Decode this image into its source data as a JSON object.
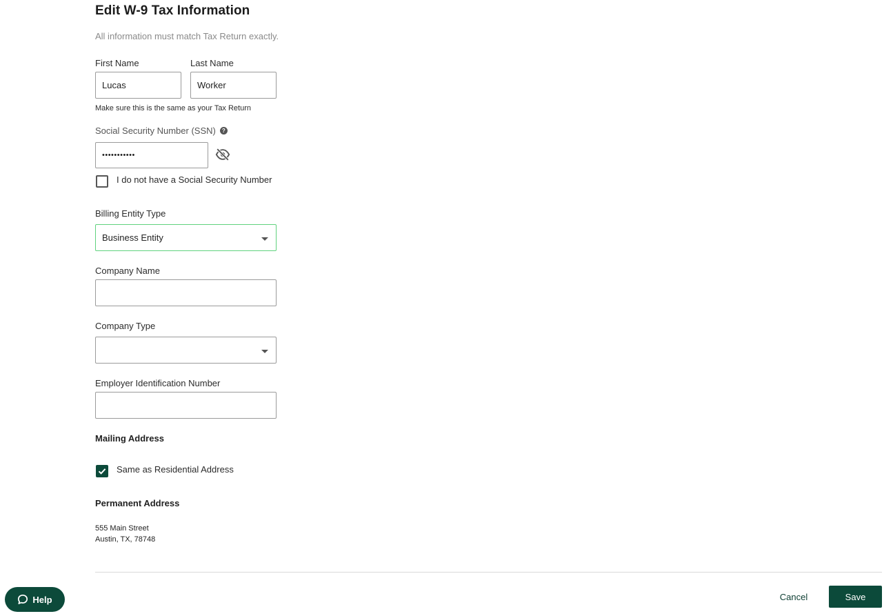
{
  "header": {
    "title": "Edit W-9 Tax Information",
    "subtitle": "All information must match Tax Return exactly."
  },
  "name": {
    "first_label": "First Name",
    "first_value": "Lucas",
    "last_label": "Last Name",
    "last_value": "Worker",
    "hint": "Make sure this is the same as your Tax Return"
  },
  "ssn": {
    "label": "Social Security Number (SSN)",
    "help_icon": "?",
    "value": "•••••••••••",
    "toggle_icon": "eye-off-icon",
    "no_ssn_label": "I do not have a Social Security Number",
    "no_ssn_checked": false
  },
  "billing": {
    "label": "Billing Entity Type",
    "value": "Business Entity"
  },
  "company": {
    "name_label": "Company Name",
    "name_value": "",
    "type_label": "Company Type",
    "type_value": "",
    "ein_label": "Employer Identification Number",
    "ein_value": ""
  },
  "mailing": {
    "heading": "Mailing Address",
    "same_label": "Same as Residential Address",
    "same_checked": true
  },
  "permanent": {
    "heading": "Permanent Address",
    "line1": "555 Main Street",
    "line2": "Austin, TX, 78748"
  },
  "actions": {
    "cancel": "Cancel",
    "save": "Save"
  },
  "help": {
    "label": "Help"
  },
  "colors": {
    "primary": "#0c4a3a",
    "focus_border": "#5fd27d"
  }
}
